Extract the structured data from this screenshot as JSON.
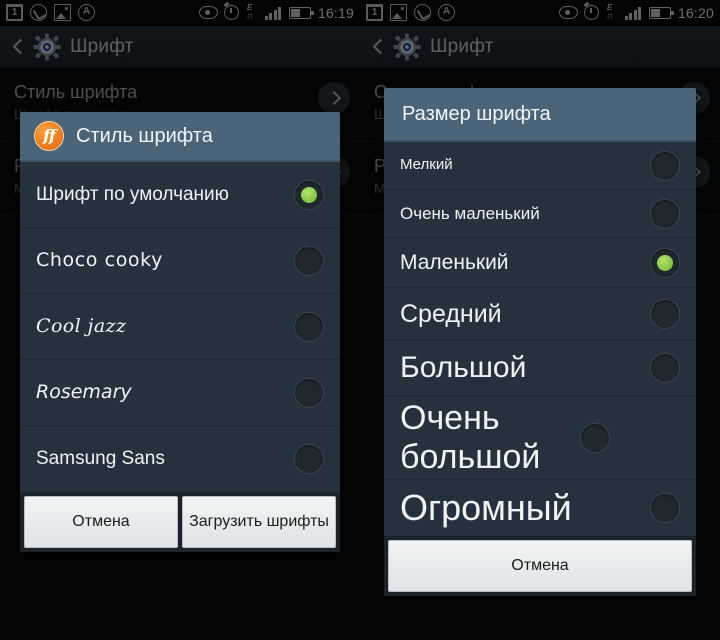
{
  "left_phone": {
    "statusbar": {
      "icons": [
        "calendar-icon",
        "phone-icon",
        "image-icon",
        "atmark-icon"
      ],
      "right_icons": [
        "eye-icon",
        "alarm-icon",
        "edge-data-icon",
        "signal-icon",
        "battery-icon"
      ],
      "edge_label": "E",
      "time": "16:19"
    },
    "actionbar": {
      "back": "back-icon",
      "app_icon": "settings-gear-icon",
      "title": "Шрифт"
    },
    "background_rows": [
      {
        "title": "Стиль шрифта",
        "subtitle": "Шрифт по умолчанию"
      },
      {
        "title": "Размер шрифта",
        "subtitle": "Маленький"
      }
    ],
    "dialog": {
      "icon": "ff-font-icon",
      "icon_text": "ff",
      "title": "Стиль шрифта",
      "options": [
        {
          "label": "Шрифт по умолчанию",
          "selected": true,
          "style": "f-default"
        },
        {
          "label": "Choco cooky",
          "selected": false,
          "style": "f-choco"
        },
        {
          "label": "Cool jazz",
          "selected": false,
          "style": "f-cooljazz"
        },
        {
          "label": "Rosemary",
          "selected": false,
          "style": "f-rosemary"
        },
        {
          "label": "Samsung Sans",
          "selected": false,
          "style": "f-samsung"
        }
      ],
      "buttons": [
        {
          "label": "Отмена"
        },
        {
          "label": "Загрузить шрифты"
        }
      ]
    }
  },
  "right_phone": {
    "statusbar": {
      "icons": [
        "calendar-icon",
        "image-icon",
        "phone-icon",
        "atmark-icon"
      ],
      "right_icons": [
        "eye-icon",
        "alarm-icon",
        "edge-data-icon",
        "signal-icon",
        "battery-icon"
      ],
      "edge_label": "E",
      "time": "16:20"
    },
    "actionbar": {
      "back": "back-icon",
      "app_icon": "settings-gear-icon",
      "title": "Шрифт"
    },
    "background_rows": [
      {
        "title": "Стиль шрифта",
        "subtitle": "Шрифт по умолчанию"
      },
      {
        "title": "Размер шрифта",
        "subtitle": "Маленький"
      }
    ],
    "dialog": {
      "title": "Размер шрифта",
      "options": [
        {
          "label": "Мелкий",
          "selected": false,
          "size": "s1"
        },
        {
          "label": "Очень маленький",
          "selected": false,
          "size": "s2"
        },
        {
          "label": "Маленький",
          "selected": true,
          "size": "s3"
        },
        {
          "label": "Средний",
          "selected": false,
          "size": "s4"
        },
        {
          "label": "Большой",
          "selected": false,
          "size": "s5"
        },
        {
          "label": "Очень большой",
          "selected": false,
          "size": "s6"
        },
        {
          "label": "Огромный",
          "selected": false,
          "size": "s7"
        }
      ],
      "buttons": [
        {
          "label": "Отмена"
        }
      ]
    }
  },
  "colors": {
    "dialog_header": "#4b6477",
    "dialog_body": "#25323d",
    "accent_green": "#7dc241",
    "ff_orange": "#e8761c",
    "actionbar": "#24303a",
    "button_face": "#e8ecee"
  }
}
